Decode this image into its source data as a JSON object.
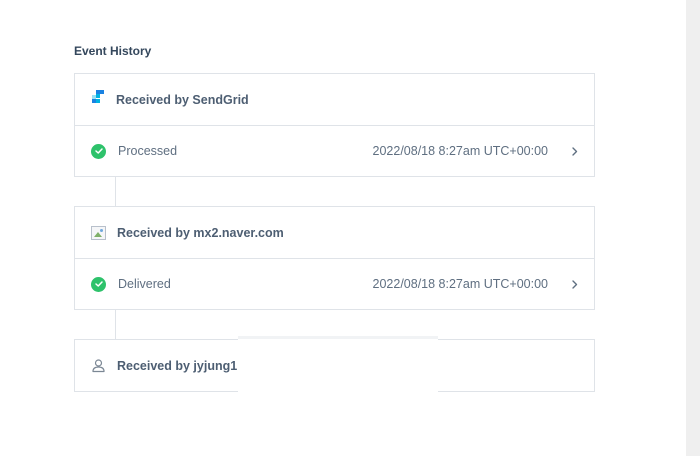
{
  "section": {
    "title": "Event History"
  },
  "events": [
    {
      "header_label": "Received by SendGrid",
      "row_label": "Processed",
      "row_time": "2022/08/18 8:27am UTC+00:00"
    },
    {
      "header_label": "Received by mx2.naver.com",
      "row_label": "Delivered",
      "row_time": "2022/08/18 8:27am UTC+00:00"
    },
    {
      "header_label": "Received by jyjung1"
    }
  ],
  "icons": {
    "sendgrid": "sendgrid-logo-icon",
    "broken_image": "broken-image-icon",
    "check": "check-circle-icon",
    "chevron": "chevron-right-icon",
    "person": "person-icon"
  },
  "colors": {
    "success": "#2ec26b",
    "border": "#dfe3e8",
    "text": "#3b4a5c"
  }
}
